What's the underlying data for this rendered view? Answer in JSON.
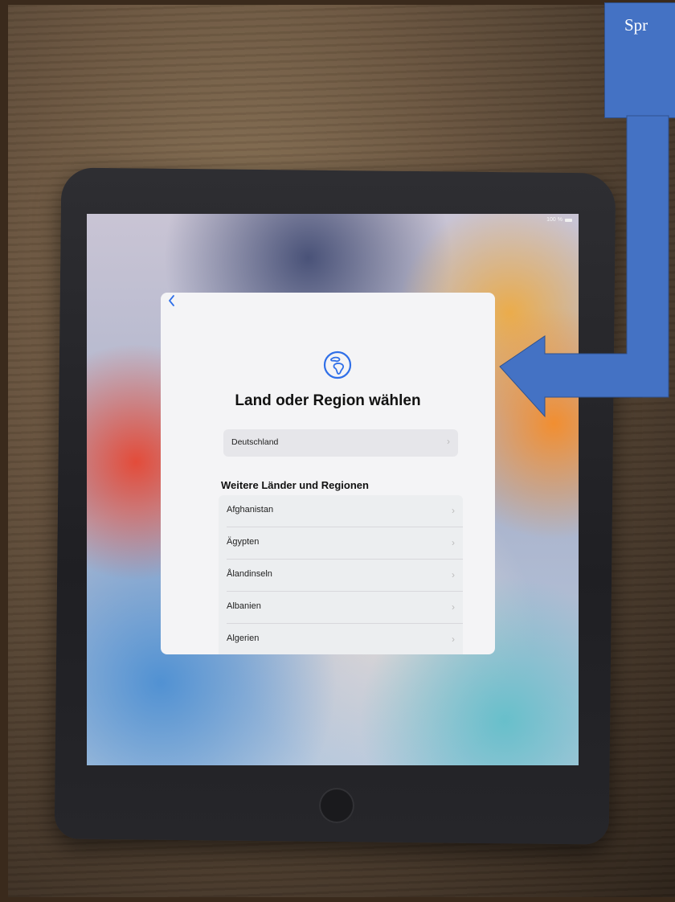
{
  "annotation": {
    "text": "Spr",
    "color": "#4472c4"
  },
  "status_bar": {
    "battery_text": "100 %"
  },
  "setup": {
    "back_icon": "chevron-left-icon",
    "header_icon": "globe-icon",
    "title": "Land oder Region wählen",
    "current_country": "Deutschland",
    "section_header": "Weitere Länder und Regionen",
    "countries": [
      "Afghanistan",
      "Ägypten",
      "Ålandinseln",
      "Albanien",
      "Algerien"
    ],
    "accent_color": "#2f6fe8"
  }
}
